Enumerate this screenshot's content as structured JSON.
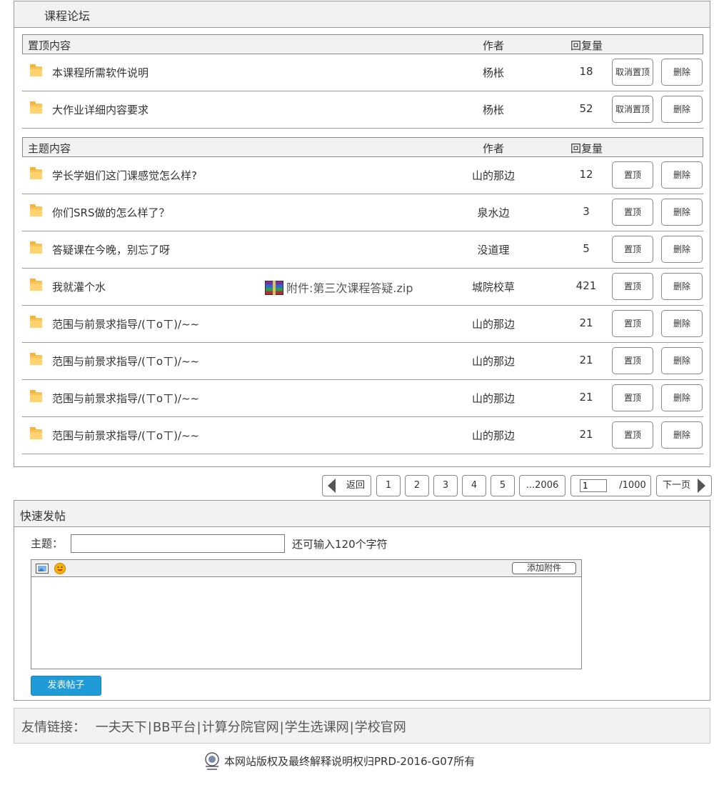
{
  "forum": {
    "title": "课程论坛",
    "pinned_header": {
      "topic": "置顶内容",
      "author": "作者",
      "replies": "回复量"
    },
    "pinned": [
      {
        "title": "本课程所需软件说明",
        "author": "杨枨",
        "replies": "18",
        "action": "取消置顶",
        "delete": "删除"
      },
      {
        "title": "大作业详细内容要求",
        "author": "杨枨",
        "replies": "52",
        "action": "取消置顶",
        "delete": "删除"
      }
    ],
    "topics_header": {
      "topic": "主题内容",
      "author": "作者",
      "replies": "回复量"
    },
    "topics": [
      {
        "title": "学长学姐们这门课感觉怎么样?",
        "author": "山的那边",
        "replies": "12",
        "action": "置顶",
        "delete": "删除"
      },
      {
        "title": "你们SRS做的怎么样了？",
        "author": "泉水边",
        "replies": "3",
        "action": "置顶",
        "delete": "删除"
      },
      {
        "title": "答疑课在今晚，别忘了呀",
        "author": "没道理",
        "replies": "5",
        "action": "置顶",
        "delete": "删除"
      },
      {
        "title": "我就灌个水",
        "attachment": "附件:第三次课程答疑.zip",
        "author": "城院校草",
        "replies": "421",
        "action": "置顶",
        "delete": "删除"
      },
      {
        "title": "范围与前景求指导/(ㄒoㄒ)/~~",
        "author": "山的那边",
        "replies": "21",
        "action": "置顶",
        "delete": "删除"
      },
      {
        "title": "范围与前景求指导/(ㄒoㄒ)/~~",
        "author": "山的那边",
        "replies": "21",
        "action": "置顶",
        "delete": "删除"
      },
      {
        "title": "范围与前景求指导/(ㄒoㄒ)/~~",
        "author": "山的那边",
        "replies": "21",
        "action": "置顶",
        "delete": "删除"
      },
      {
        "title": "范围与前景求指导/(ㄒoㄒ)/~~",
        "author": "山的那边",
        "replies": "21",
        "action": "置顶",
        "delete": "删除"
      }
    ]
  },
  "pagination": {
    "back": "返回",
    "pages": [
      "1",
      "2",
      "3",
      "4",
      "5",
      "...2006"
    ],
    "current_page_value": "1",
    "total": "/1000页",
    "next": "下一页"
  },
  "quick_post": {
    "title": "快速发帖",
    "subject_label": "主题：",
    "subject_value": "",
    "char_hint": "还可输入120个字符",
    "add_attachment": "添加附件",
    "submit": "发表帖子",
    "icons": [
      "image-icon",
      "emoji-icon"
    ]
  },
  "footer": {
    "links_label": "友情链接：",
    "links": [
      "一夫天下",
      "BB平台",
      "计算分院官网",
      "学生选课网",
      "学校官网"
    ],
    "copyright": "本网站版权及最终解释说明权归PRD-2016-G07所有"
  },
  "colors": {
    "accent": "#1f9bd7",
    "folder": "#fcc254",
    "panel_bg": "#f2f2f2",
    "border": "#999999"
  }
}
